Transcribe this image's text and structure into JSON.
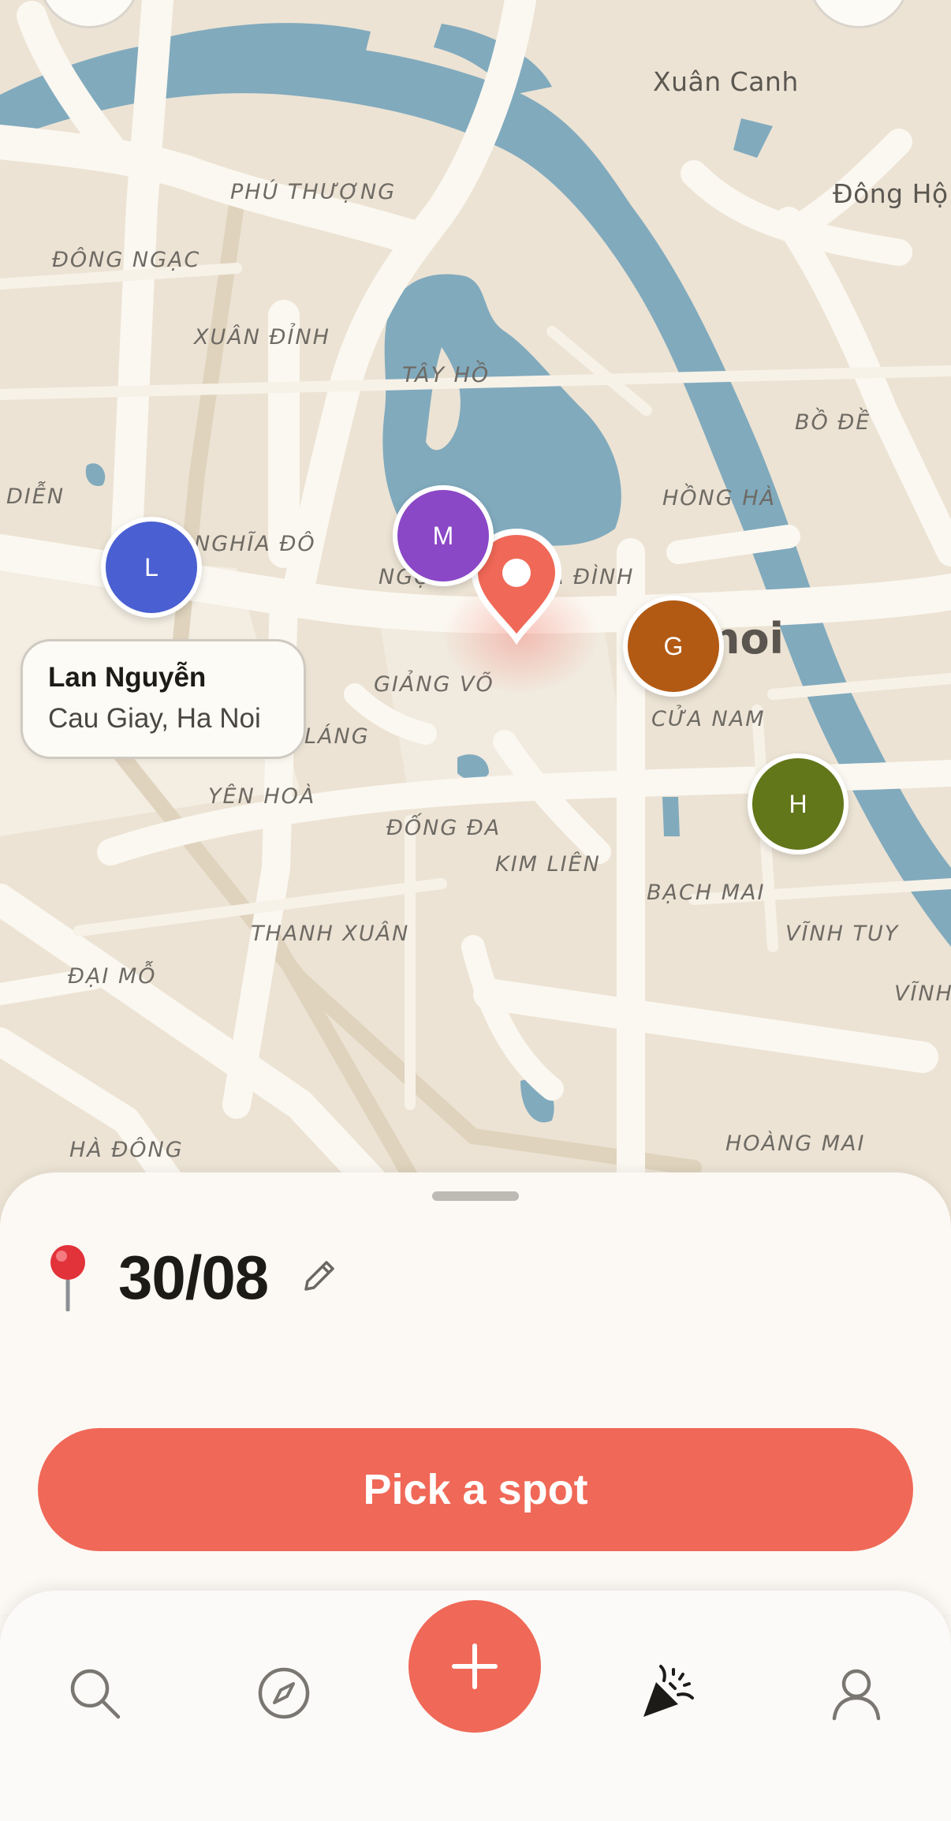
{
  "map": {
    "place_labels": [
      {
        "text": "Xuân Canh"
      },
      {
        "text": "PHÚ THƯỢNG"
      },
      {
        "text": "Đông Hộ"
      },
      {
        "text": "ĐÔNG NGẠC"
      },
      {
        "text": "XUÂN ĐỈNH"
      },
      {
        "text": "TÂY HỒ"
      },
      {
        "text": "BỒ ĐỀ"
      },
      {
        "text": "DIỄN"
      },
      {
        "text": "HỒNG HÀ"
      },
      {
        "text": "NGHĨA ĐÔ"
      },
      {
        "text": "NGỌ"
      },
      {
        "text": "A ĐÌNH"
      },
      {
        "text": "GIẢNG VÕ"
      },
      {
        "text": "noi"
      },
      {
        "text": "CỬA NAM"
      },
      {
        "text": "LÁNG"
      },
      {
        "text": "YÊN HOÀ"
      },
      {
        "text": "ĐỐNG ĐA"
      },
      {
        "text": "KIM LIÊN"
      },
      {
        "text": "BẠCH MAI"
      },
      {
        "text": "THANH XUÂN"
      },
      {
        "text": "VĨNH TUY"
      },
      {
        "text": "ĐẠI MỖ"
      },
      {
        "text": "VĨNH"
      },
      {
        "text": "HÀ ĐÔNG"
      },
      {
        "text": "HOÀNG MAI"
      }
    ],
    "avatars": [
      {
        "initial": "L",
        "color": "#4a5fd1"
      },
      {
        "initial": "M",
        "color": "#8a47c6"
      },
      {
        "initial": "G",
        "color": "#b25a14"
      },
      {
        "initial": "H",
        "color": "#62761a"
      }
    ],
    "tooltip": {
      "name": "Lan Nguyễn",
      "location": "Cau Giay, Ha Noi"
    },
    "pin_color": "#f06857"
  },
  "sheet": {
    "title": "30/08",
    "pin_icon": "round-pushpin-icon",
    "edit_icon": "pencil-icon",
    "cta_label": "Pick a spot",
    "accent": "#f06857"
  },
  "tabbar": {
    "items": [
      {
        "icon": "search-icon"
      },
      {
        "icon": "compass-icon"
      },
      {
        "icon": "plus-icon"
      },
      {
        "icon": "party-popper-icon",
        "active": true
      },
      {
        "icon": "user-icon"
      }
    ]
  }
}
